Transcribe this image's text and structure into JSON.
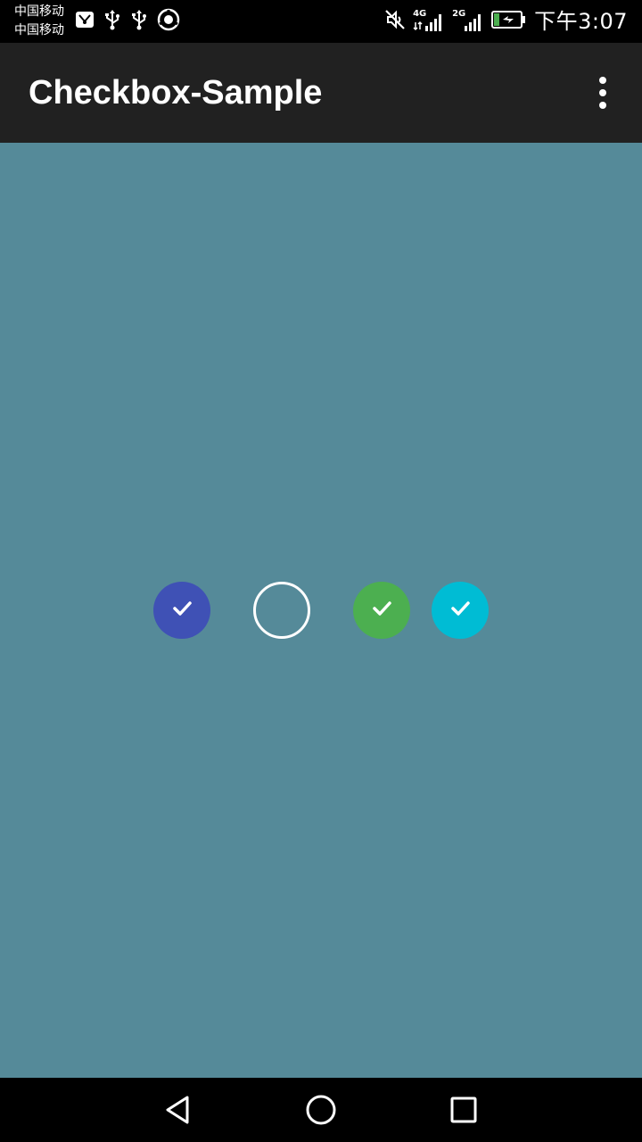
{
  "status_bar": {
    "carrier_1": "中国移动",
    "carrier_2": "中国移动",
    "network_1": "4G",
    "network_2": "2G",
    "time": "下午3:07",
    "left_icons": [
      "app-notification-icon",
      "usb-icon",
      "usb-icon",
      "sync-icon"
    ],
    "right_icons": [
      "mute-icon",
      "signal-4g-icon",
      "signal-2g-icon",
      "battery-charging-icon"
    ]
  },
  "app_bar": {
    "title": "Checkbox-Sample",
    "overflow_icon": "more-vert-icon"
  },
  "checkboxes": [
    {
      "checked": true,
      "color": "#3F51B5"
    },
    {
      "checked": false,
      "color": "#FFFFFF"
    },
    {
      "checked": true,
      "color": "#4CAF50"
    },
    {
      "checked": true,
      "color": "#00BCD4"
    }
  ],
  "colors": {
    "background": "#558A99",
    "app_bar": "#212121",
    "status_bar": "#000000",
    "nav_bar": "#000000"
  },
  "nav_bar": {
    "buttons": [
      "back-icon",
      "home-icon",
      "recents-icon"
    ]
  }
}
